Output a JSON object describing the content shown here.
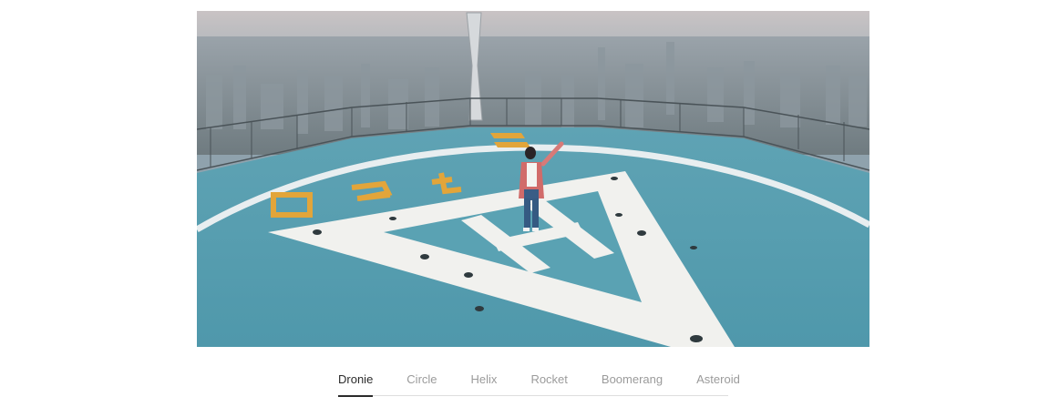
{
  "media": {
    "scene": "helipad-rooftop-city-view"
  },
  "modes": {
    "active": "Dronie",
    "tabs": [
      {
        "label": "Dronie"
      },
      {
        "label": "Circle"
      },
      {
        "label": "Helix"
      },
      {
        "label": "Rocket"
      },
      {
        "label": "Boomerang"
      },
      {
        "label": "Asteroid"
      }
    ]
  },
  "colors": {
    "active_tab": "#2b2b2b",
    "inactive_tab": "#9b9b9b",
    "divider": "#dedede"
  }
}
